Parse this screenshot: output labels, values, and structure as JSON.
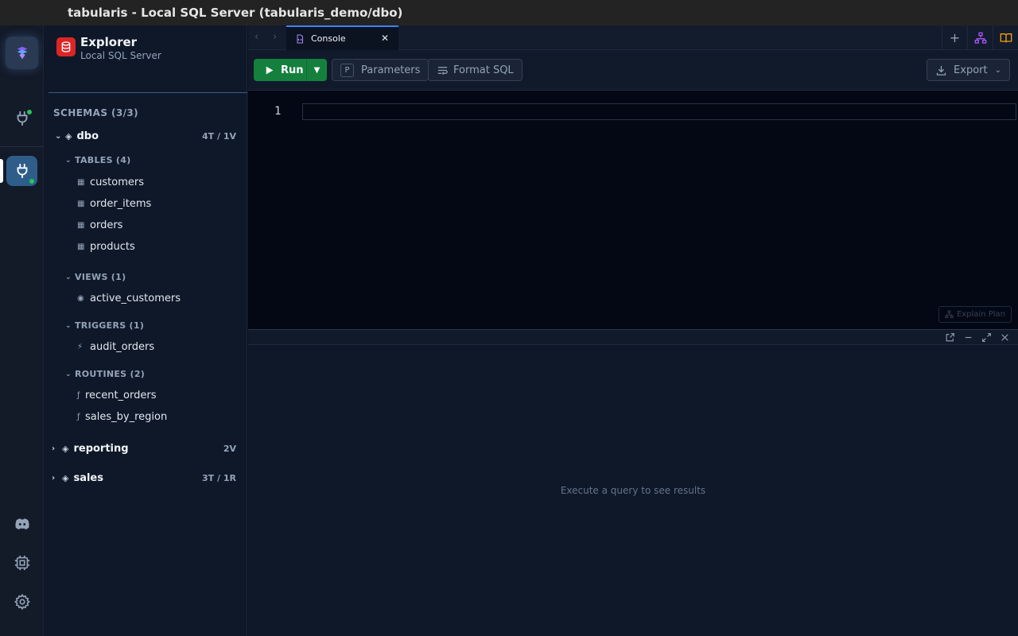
{
  "window": {
    "title": "tabularis - Local SQL Server (tabularis_demo/dbo)"
  },
  "colors": {
    "run": "#15803d",
    "accent": "#3b82f6",
    "status_online": "#22c55e",
    "db_icon": "#dc2626"
  },
  "rail": {
    "icons": [
      "app-logo-icon",
      "connections-icon",
      "active-connection-icon",
      "discord-icon",
      "cpu-icon",
      "settings-icon"
    ]
  },
  "sidebar": {
    "title": "Explorer",
    "subtitle": "Local SQL Server",
    "schemas_header": "SCHEMAS (3/3)",
    "schemas": [
      {
        "name": "dbo",
        "count": "4T / 1V",
        "expanded": true,
        "groups": [
          {
            "label": "TABLES (4)",
            "icon": "table-icon",
            "items": [
              "customers",
              "order_items",
              "orders",
              "products"
            ]
          },
          {
            "label": "VIEWS (1)",
            "icon": "view-icon",
            "items": [
              "active_customers"
            ]
          },
          {
            "label": "TRIGGERS (1)",
            "icon": "trigger-icon",
            "items": [
              "audit_orders"
            ]
          },
          {
            "label": "ROUTINES (2)",
            "icon": "function-icon",
            "items": [
              "recent_orders",
              "sales_by_region"
            ]
          }
        ]
      },
      {
        "name": "reporting",
        "count": "2V",
        "expanded": false
      },
      {
        "name": "sales",
        "count": "3T / 1R",
        "expanded": false
      }
    ]
  },
  "tabs": [
    {
      "label": "Console",
      "active": true
    }
  ],
  "toolbar": {
    "run_label": "Run",
    "parameters_key": "P",
    "parameters_label": "Parameters",
    "format_label": "Format SQL",
    "export_label": "Export"
  },
  "editor": {
    "line_number": "1",
    "explain_label": "Explain Plan"
  },
  "results": {
    "empty_message": "Execute a query to see results"
  }
}
